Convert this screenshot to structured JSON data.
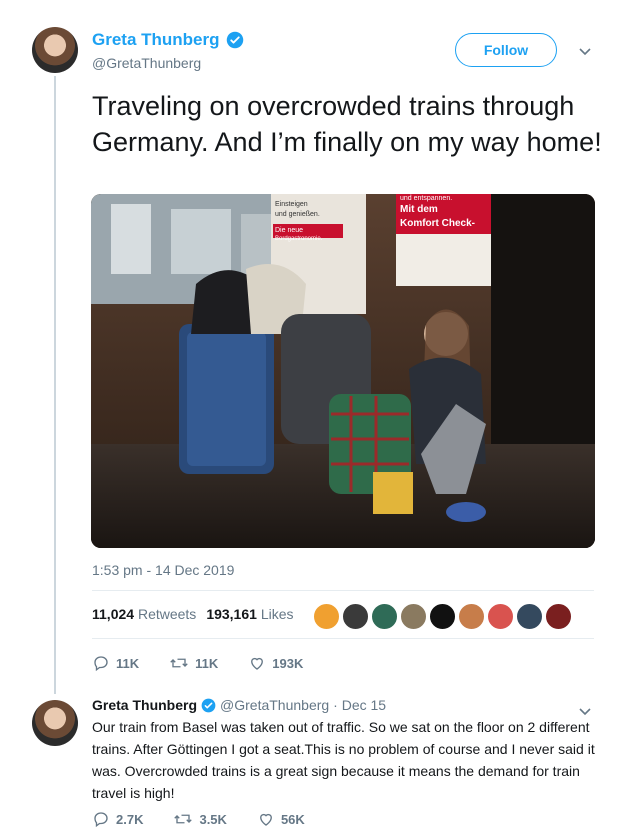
{
  "tweet": {
    "author_name": "Greta Thunberg",
    "author_handle": "@GretaThunberg",
    "follow_label": "Follow",
    "text": "Traveling on overcrowded trains through Germany. And I’m finally on my way home!",
    "photo": {
      "sign_left_line1": "Einsteigen",
      "sign_left_line2": "und genießen.",
      "sign_left_line3": "Die neue",
      "sign_left_line4": "Bordgastronomie.",
      "sign_right_line0": "und entspannen.",
      "sign_right_line1": "Mit dem",
      "sign_right_line2": "Komfort Check-"
    },
    "timestamp": "1:53 pm - 14 Dec 2019",
    "retweets_count": "11,024",
    "retweets_label": "Retweets",
    "likes_count": "193,161",
    "likes_label": "Likes",
    "replies_action": "11K",
    "retweets_action": "11K",
    "likes_action": "193K",
    "liker_colors": [
      "#f0a030",
      "#3a3a3a",
      "#2f6b57",
      "#8a7a60",
      "#111111",
      "#c77d4a",
      "#d9534f",
      "#34495e",
      "#7a1f1f"
    ]
  },
  "reply": {
    "author_name": "Greta Thunberg",
    "author_handle": "@GretaThunberg",
    "date": "· Dec 15",
    "text": "Our train from Basel was taken out of traffic. So we sat on the floor on 2 different trains. After Göttingen I got a seat.This is no problem of course and I never said it was. Overcrowded trains is a great sign because it means the demand for train travel is high!",
    "replies_action": "2.7K",
    "retweets_action": "3.5K",
    "likes_action": "56K"
  },
  "colors": {
    "accent": "#1da1f2",
    "muted": "#657786",
    "text": "#14171a"
  }
}
